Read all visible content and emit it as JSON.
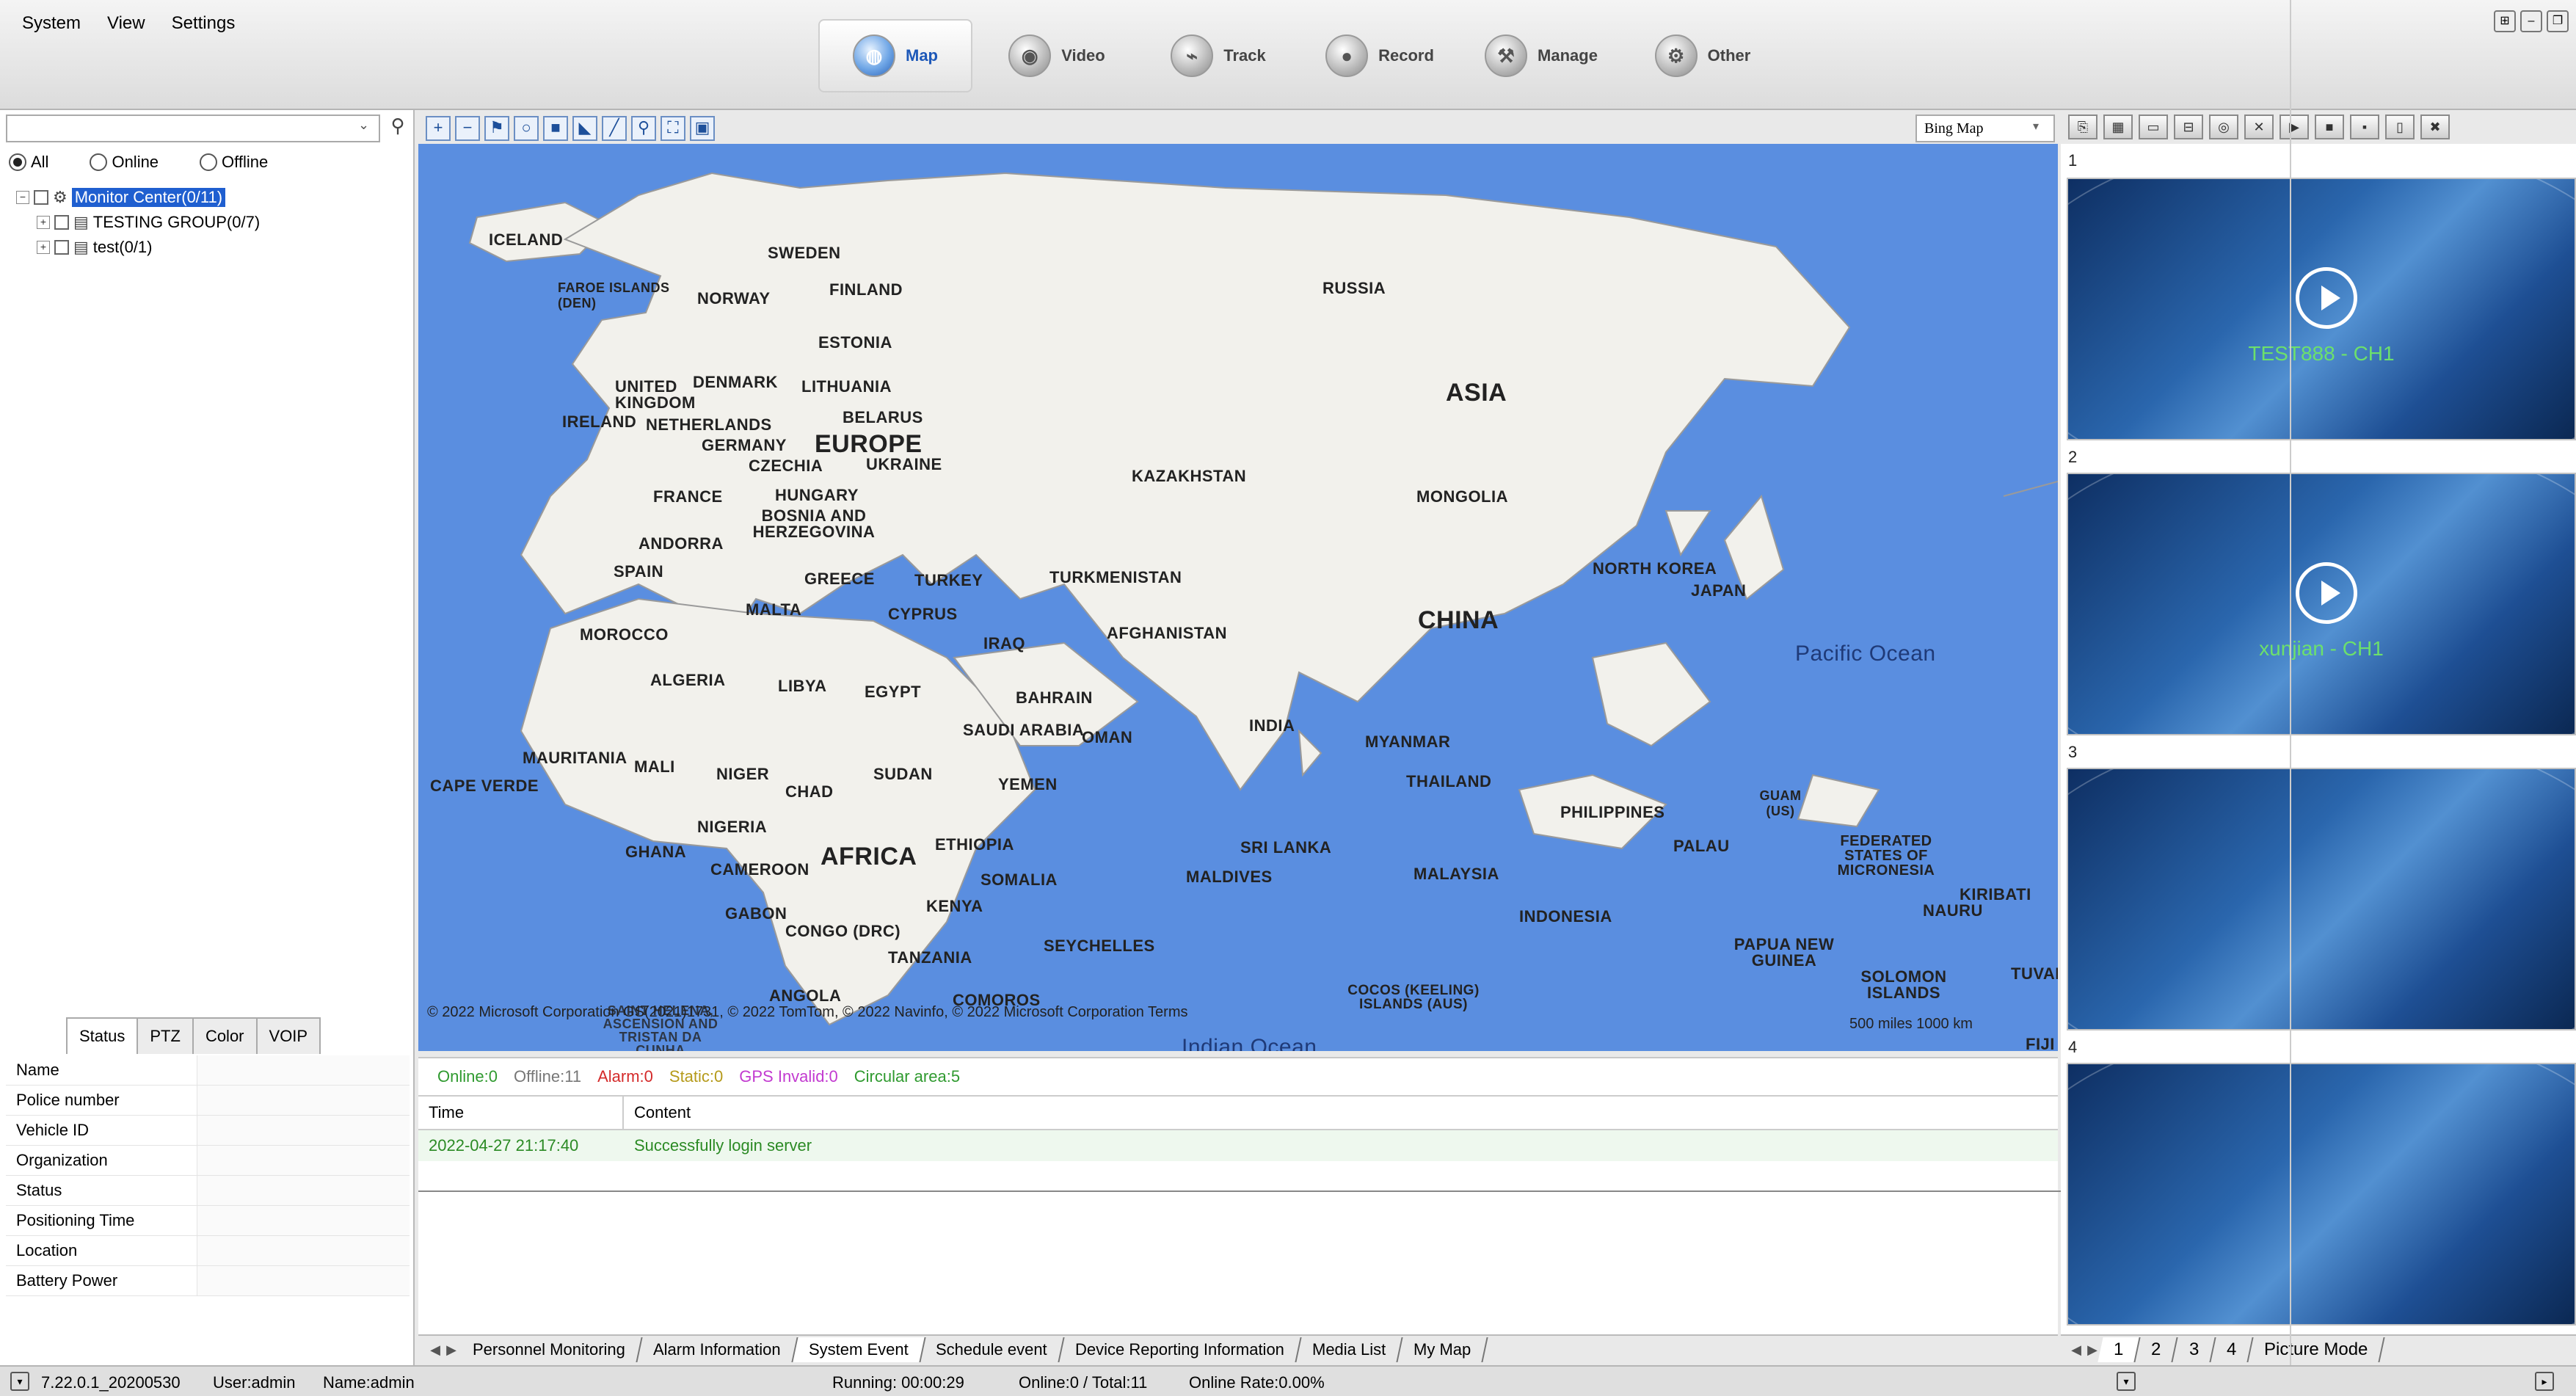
{
  "menu": [
    "System",
    "View",
    "Settings"
  ],
  "nav_tabs": [
    {
      "label": "Map",
      "active": true,
      "icon": "globe-icon"
    },
    {
      "label": "Video",
      "active": false,
      "icon": "camera-icon"
    },
    {
      "label": "Track",
      "active": false,
      "icon": "track-icon"
    },
    {
      "label": "Record",
      "active": false,
      "icon": "record-icon"
    },
    {
      "label": "Manage",
      "active": false,
      "icon": "manage-icon"
    },
    {
      "label": "Other",
      "active": false,
      "icon": "gear-icon"
    }
  ],
  "search": {
    "value": ""
  },
  "filters": [
    {
      "label": "All",
      "checked": true
    },
    {
      "label": "Online",
      "checked": false
    },
    {
      "label": "Offline",
      "checked": false
    }
  ],
  "tree": [
    {
      "label": "Monitor Center(0/11)",
      "selected": true
    },
    {
      "label": "TESTING GROUP(0/7)",
      "selected": false
    },
    {
      "label": "test(0/1)",
      "selected": false
    }
  ],
  "prop_tabs": [
    "Status",
    "PTZ",
    "Color",
    "VOIP"
  ],
  "properties": [
    "Name",
    "Police number",
    "Vehicle ID",
    "Organization",
    "Status",
    "Positioning Time",
    "Location",
    "Battery Power"
  ],
  "map": {
    "provider": "Bing Map",
    "attribution": "© 2022 Microsoft Corporation GS(2021)1731, © 2022 TomTom, © 2022 Navinfo, © 2022 Microsoft Corporation  Terms",
    "scale": "500 miles   1000 km",
    "labels": {
      "iceland": "ICELAND",
      "sweden": "SWEDEN",
      "finland": "FINLAND",
      "russia": "RUSSIA",
      "faroe": "FAROE ISLANDS (DEN)",
      "norway": "NORWAY",
      "estonia": "ESTONIA",
      "uk": "UNITED KINGDOM",
      "denmark": "DENMARK",
      "lithuania": "LITHUANIA",
      "belarus": "BELARUS",
      "ireland": "IRELAND",
      "netherlands": "NETHERLANDS",
      "germany": "GERMANY",
      "europe": "EUROPE",
      "czechia": "CZECHIA",
      "ukraine": "UKRAINE",
      "asia": "ASIA",
      "kazakhstan": "KAZAKHSTAN",
      "mongolia": "MONGOLIA",
      "france": "FRANCE",
      "hungary": "HUNGARY",
      "bosnia": "BOSNIA AND HERZEGOVINA",
      "andorra": "ANDORRA",
      "spain": "SPAIN",
      "greece": "GREECE",
      "turkey": "TURKEY",
      "turkmenistan": "TURKMENISTAN",
      "northkorea": "NORTH KOREA",
      "japan": "JAPAN",
      "malta": "MALTA",
      "cyprus": "CYPRUS",
      "morocco": "MOROCCO",
      "iraq": "IRAQ",
      "afghanistan": "AFGHANISTAN",
      "china": "CHINA",
      "pacific": "Pacific Ocean",
      "algeria": "ALGERIA",
      "libya": "LIBYA",
      "egypt": "EGYPT",
      "bahrain": "BAHRAIN",
      "saudi": "SAUDI ARABIA",
      "oman": "OMAN",
      "india": "INDIA",
      "myanmar": "MYANMAR",
      "mauritania": "MAURITANIA",
      "mali": "MALI",
      "niger": "NIGER",
      "sudan": "SUDAN",
      "capeverde": "CAPE VERDE",
      "chad": "CHAD",
      "yemen": "YEMEN",
      "thailand": "THAILAND",
      "philippines": "PHILIPPINES",
      "guam": "GUAM (US)",
      "nigeria": "NIGERIA",
      "ethiopia": "ETHIOPIA",
      "srilanka": "SRI LANKA",
      "palau": "PALAU",
      "micronesia": "FEDERATED STATES OF MICRONESIA",
      "ghana": "GHANA",
      "africa": "AFRICA",
      "cameroon": "CAMEROON",
      "somalia": "SOMALIA",
      "maldives": "MALDIVES",
      "malaysia": "MALAYSIA",
      "kiribati": "KIRIBATI",
      "nauru": "NAURU",
      "kenya": "KENYA",
      "gabon": "GABON",
      "indonesia": "INDONESIA",
      "congo": "CONGO (DRC)",
      "seychelles": "SEYCHELLES",
      "png": "PAPUA NEW GUINEA",
      "tanzania": "TANZANIA",
      "solomon": "SOLOMON ISLANDS",
      "tuval": "TUVAL",
      "angola": "ANGOLA",
      "comoros": "COMOROS",
      "cocos": "COCOS (KEELING) ISLANDS (AUS)",
      "saint": "SAINT HELENA, ASCENSION AND TRISTAN DA CUNHA",
      "fiji": "FIJI",
      "indianocean": "Indian Ocean"
    }
  },
  "status": {
    "online": "Online:0",
    "offline": "Offline:11",
    "alarm": "Alarm:0",
    "static": "Static:0",
    "gps_invalid": "GPS Invalid:0",
    "circular": "Circular area:5",
    "colors": {
      "online": "#2f9a2f",
      "offline": "#777777",
      "alarm": "#d42a2a",
      "static": "#b59a1a",
      "gps_invalid": "#c23ad0",
      "circular": "#2f9a2f"
    }
  },
  "events": {
    "headers": [
      "Time",
      "Content"
    ],
    "rows": [
      {
        "time": "2022-04-27 21:17:40",
        "content": "Successfully login server"
      }
    ]
  },
  "bottom_tabs": [
    {
      "label": "Personnel Monitoring",
      "active": false
    },
    {
      "label": "Alarm Information",
      "active": false
    },
    {
      "label": "System Event",
      "active": true
    },
    {
      "label": "Schedule event",
      "active": false
    },
    {
      "label": "Device Reporting Information",
      "active": false
    },
    {
      "label": "Media List",
      "active": false
    },
    {
      "label": "My Map",
      "active": false
    }
  ],
  "video_cells": [
    {
      "num": "1",
      "label": "TEST888 - CH1",
      "playing": true
    },
    {
      "num": "2",
      "label": "xunjian - CH1",
      "playing": true
    },
    {
      "num": "3",
      "label": "",
      "playing": false
    },
    {
      "num": "4",
      "label": "",
      "playing": false
    }
  ],
  "video_tabs": [
    "1",
    "2",
    "3",
    "4",
    "Picture Mode"
  ],
  "statusbar": {
    "version": "7.22.0.1_20200530",
    "user": "User:admin",
    "name": "Name:admin",
    "running": "Running: 00:00:29",
    "online": "Online:0 / Total:11",
    "rate": "Online Rate:0.00%"
  }
}
